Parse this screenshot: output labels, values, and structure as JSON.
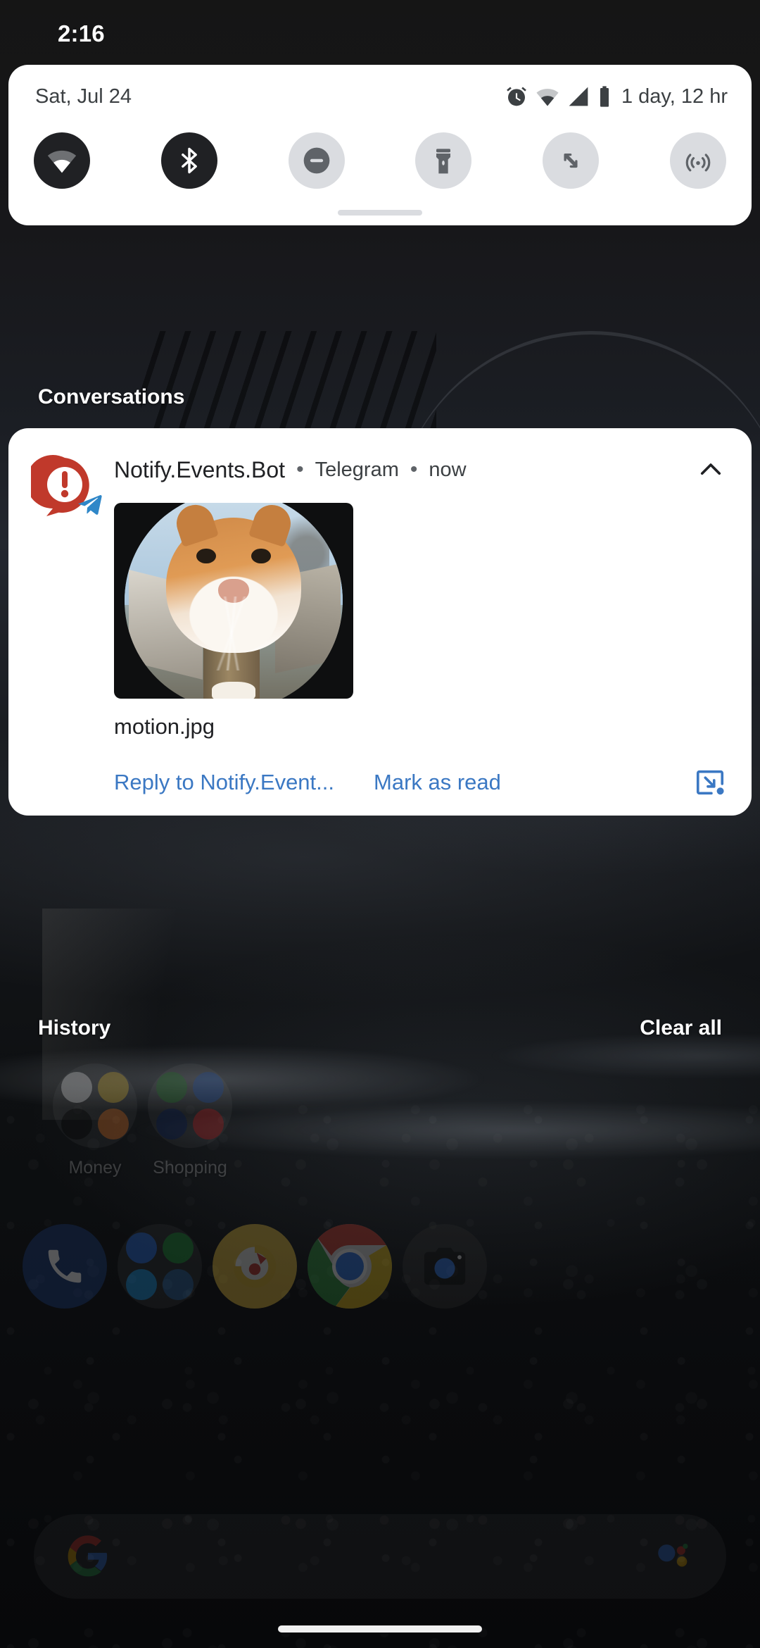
{
  "statusbar": {
    "clock": "2:16"
  },
  "quick_settings": {
    "date": "Sat, Jul 24",
    "status_icons": [
      "alarm-icon",
      "wifi-icon",
      "cellular-signal-icon",
      "battery-icon"
    ],
    "battery_estimate": "1 day, 12 hr",
    "tiles": [
      {
        "name": "internet",
        "icon": "wifi-icon",
        "state": "on"
      },
      {
        "name": "bluetooth",
        "icon": "bluetooth-icon",
        "state": "on"
      },
      {
        "name": "do-not-disturb",
        "icon": "do-not-disturb-icon",
        "state": "off"
      },
      {
        "name": "flashlight",
        "icon": "flashlight-icon",
        "state": "off"
      },
      {
        "name": "auto-rotate",
        "icon": "auto-rotate-icon",
        "state": "off"
      },
      {
        "name": "nearby-share",
        "icon": "nearby-share-icon",
        "state": "off"
      }
    ]
  },
  "sections": {
    "conversations_label": "Conversations",
    "history_label": "History",
    "clear_all_label": "Clear all"
  },
  "notification": {
    "app_name": "Notify.Events.Bot",
    "separator": "•",
    "channel": "Telegram",
    "time": "now",
    "avatar_icon": "alert-bubble-icon",
    "badge_icon": "telegram-icon",
    "collapse_icon": "chevron-up-icon",
    "attachment_name": "motion.jpg",
    "attachment_alt": "fisheye photo of an orange and white cat",
    "actions": {
      "reply_label": "Reply to Notify.Event...",
      "mark_read_label": "Mark as read",
      "bubble_icon": "open-bubble-icon"
    }
  },
  "home": {
    "folders": [
      {
        "label": "Money",
        "name": "folder-money"
      },
      {
        "label": "Shopping",
        "name": "folder-shopping"
      }
    ],
    "dock": [
      {
        "name": "phone-icon",
        "label": ""
      },
      {
        "name": "social-folder",
        "label": ""
      },
      {
        "name": "music-icon",
        "label": ""
      },
      {
        "name": "chrome-icon",
        "label": ""
      },
      {
        "name": "camera-icon",
        "label": ""
      }
    ]
  },
  "search": {
    "google_icon": "google-g-icon",
    "assistant_icon": "google-assistant-icon",
    "placeholder": ""
  },
  "colors": {
    "accent_link": "#3b78c3",
    "tile_on_bg": "#202124",
    "tile_off_bg": "#dadce0",
    "card_bg": "#ffffff",
    "alert_red": "#c0392b",
    "telegram_blue": "#2f87c8"
  }
}
